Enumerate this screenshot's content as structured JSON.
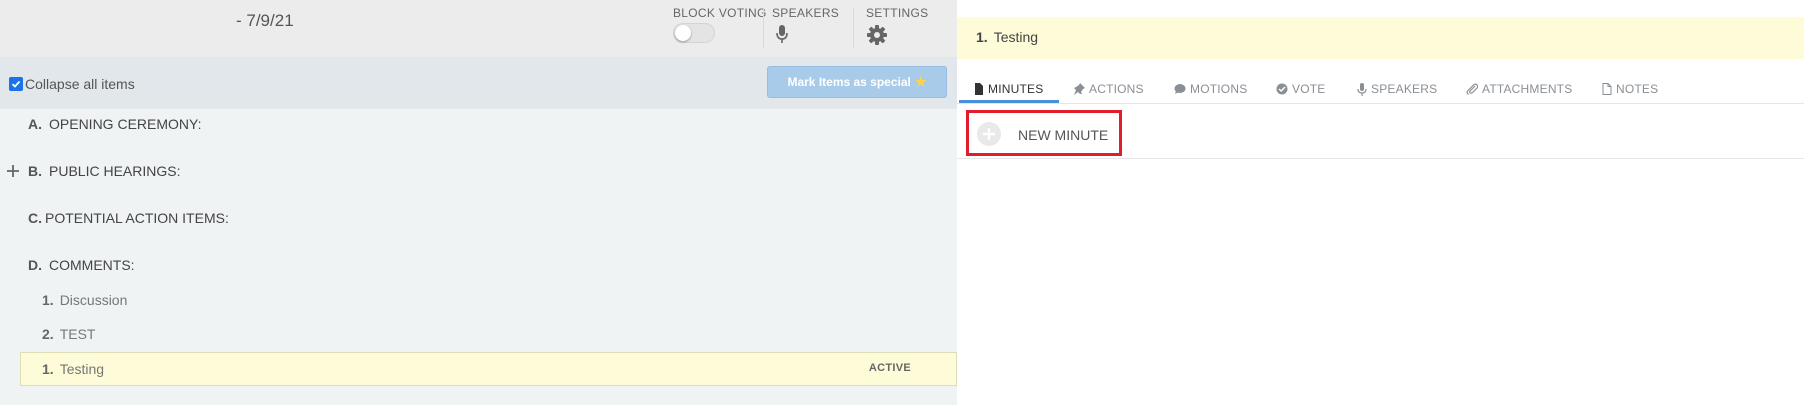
{
  "header": {
    "date": "- 7/9/21",
    "block_voting_label": "BLOCK VOTING",
    "speakers_label": "SPEAKERS",
    "settings_label": "SETTINGS"
  },
  "toolbar": {
    "collapse_label": "Collapse all items",
    "collapse_checked": true,
    "mark_special_label": "Mark Items as special"
  },
  "agenda": {
    "sections": [
      {
        "letter": "A.",
        "title": "OPENING CEREMONY:"
      },
      {
        "letter": "B.",
        "title": "PUBLIC HEARINGS:"
      },
      {
        "letter": "C.",
        "title": "POTENTIAL ACTION ITEMS:"
      },
      {
        "letter": "D.",
        "title": "COMMENTS:"
      }
    ],
    "sub_items": [
      {
        "num": "1.",
        "title": "Discussion"
      },
      {
        "num": "2.",
        "title": "TEST"
      }
    ],
    "active_item": {
      "num": "1.",
      "title": "Testing",
      "badge": "ACTIVE"
    }
  },
  "detail": {
    "item_num": "1.",
    "item_title": "Testing",
    "tabs": [
      {
        "label": "MINUTES",
        "icon": "file-icon"
      },
      {
        "label": "ACTIONS",
        "icon": "pin-icon"
      },
      {
        "label": "MOTIONS",
        "icon": "chat-icon"
      },
      {
        "label": "VOTE",
        "icon": "check-circle-icon"
      },
      {
        "label": "SPEAKERS",
        "icon": "mic-icon"
      },
      {
        "label": "ATTACHMENTS",
        "icon": "paperclip-icon"
      },
      {
        "label": "NOTES",
        "icon": "note-icon"
      }
    ],
    "active_tab": "MINUTES",
    "new_minute_label": "NEW MINUTE"
  },
  "colors": {
    "accent": "#4a90d9",
    "highlight": "#fdfbd8",
    "callout": "#e01e2b"
  }
}
